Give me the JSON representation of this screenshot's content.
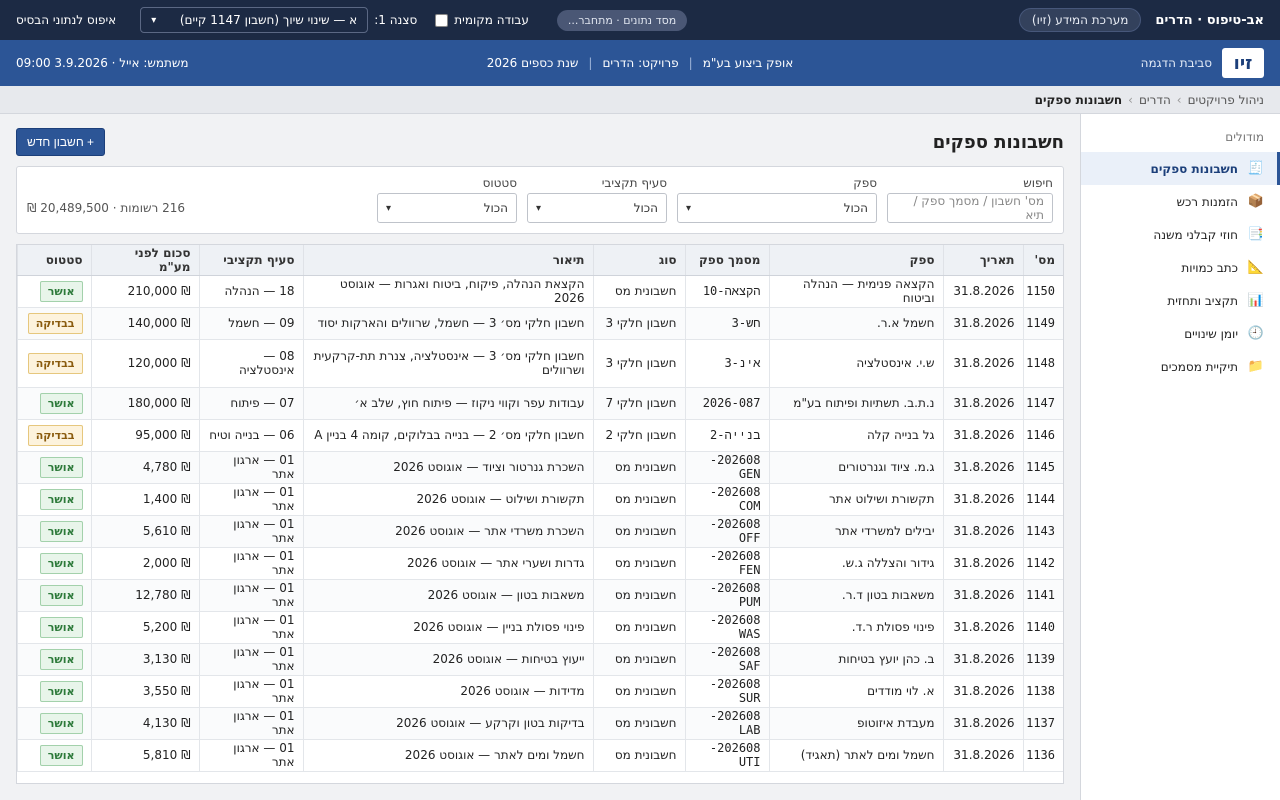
{
  "topbar": {
    "brand": "אב-טיפוס · הדרים",
    "system": "מערכת המידע (זיו)",
    "db_status": "מסד נתונים · מתחבר...",
    "local_work": "עבודה מקומית",
    "scenario_label": "סצנה 1:",
    "scenario_value": "א — שינוי שיוך (חשבון 1147 קיים)",
    "reset": "איפוס לנתוני הבסיס"
  },
  "band": {
    "logo": "זיו",
    "env": "סביבת הדגמה",
    "company": "אופק ביצוע בע\"מ",
    "project": "פרויקט: הדרים",
    "year": "שנת כספים 2026",
    "user": "משתמש: אייל · 3.9.2026 09:00"
  },
  "breadcrumb": [
    "ניהול פרויקטים",
    "הדרים",
    "חשבונות ספקים"
  ],
  "sidebar": {
    "heading": "מודולים",
    "items": [
      {
        "label": "חשבונות ספקים",
        "icon": "🧾",
        "active": true
      },
      {
        "label": "הזמנות רכש",
        "icon": "📦"
      },
      {
        "label": "חוזי קבלני משנה",
        "icon": "📑"
      },
      {
        "label": "כתב כמויות",
        "icon": "📐"
      },
      {
        "label": "תקציב ותחזית",
        "icon": "📊"
      },
      {
        "label": "יומן שינויים",
        "icon": "🕘"
      },
      {
        "label": "תיקיית מסמכים",
        "icon": "📁"
      }
    ]
  },
  "page": {
    "title": "חשבונות ספקים",
    "new_button": "+ חשבון חדש"
  },
  "filters": {
    "search_label": "חיפוש",
    "search_placeholder": "מס' חשבון / מסמך ספק / תיא",
    "supplier_label": "ספק",
    "supplier_value": "הכול",
    "budget_label": "סעיף תקציבי",
    "budget_value": "הכול",
    "status_label": "סטטוס",
    "status_value": "הכול",
    "summary": "216 רשומות · 20,489,500 ₪"
  },
  "table": {
    "headers": [
      "מס'",
      "תאריך",
      "ספק",
      "מסמך ספק",
      "סוג",
      "תיאור",
      "סעיף תקציבי",
      "סכום לפני מע\"מ",
      "סטטוס"
    ],
    "rows": [
      {
        "num": "1150",
        "date": "31.8.2026",
        "supplier": "הקצאה פנימית — הנהלה וביטוח",
        "doc": "הקצאה-10",
        "type": "חשבונית מס",
        "desc": "הקצאת הנהלה, פיקוח, ביטוח ואגרות — אוגוסט 2026",
        "budget": "18 — הנהלה",
        "amount": "₪ 210,000",
        "status": "אושר",
        "status_kind": "ok"
      },
      {
        "num": "1149",
        "date": "31.8.2026",
        "supplier": "חשמל א.ר.",
        "doc": "חש-3",
        "type": "חשבון חלקי 3",
        "desc": "חשבון חלקי מס׳ 3 — חשמל, שרוולים והארקות יסוד",
        "budget": "09 — חשמל",
        "amount": "₪ 140,000",
        "status": "בבדיקה",
        "status_kind": "chk"
      },
      {
        "num": "1148",
        "date": "31.8.2026",
        "supplier": "ש.י. אינסטלציה",
        "doc": "אינ-3",
        "type": "חשבון חלקי 3",
        "desc": "חשבון חלקי מס׳ 3 — אינסטלציה, צנרת תת-קרקעית ושרוולים",
        "budget": "08 — אינסטלציה",
        "amount": "₪ 120,000",
        "status": "בבדיקה",
        "status_kind": "chk",
        "tall": true
      },
      {
        "num": "1147",
        "date": "31.8.2026",
        "supplier": "נ.ת.ב. תשתיות ופיתוח בע\"מ",
        "doc": "2026-087",
        "type": "חשבון חלקי 7",
        "desc": "עבודות עפר וקווי ניקוז — פיתוח חוץ, שלב א׳",
        "budget": "07 — פיתוח",
        "amount": "₪ 180,000",
        "status": "אושר",
        "status_kind": "ok"
      },
      {
        "num": "1146",
        "date": "31.8.2026",
        "supplier": "גל בנייה קלה",
        "doc": "בנייה-2",
        "type": "חשבון חלקי 2",
        "desc": "חשבון חלקי מס׳ 2 — בנייה בבלוקים, קומה 4 בניין A",
        "budget": "06 — בנייה וטיח",
        "amount": "₪ 95,000",
        "status": "בבדיקה",
        "status_kind": "chk"
      },
      {
        "num": "1145",
        "date": "31.8.2026",
        "supplier": "ג.מ. ציוד וגנרטורים",
        "doc": "202608-GEN",
        "type": "חשבונית מס",
        "desc": "השכרת גנרטור וציוד — אוגוסט 2026",
        "budget": "01 — ארגון אתר",
        "amount": "₪ 4,780",
        "status": "אושר",
        "status_kind": "ok"
      },
      {
        "num": "1144",
        "date": "31.8.2026",
        "supplier": "תקשורת ושילוט אתר",
        "doc": "202608-COM",
        "type": "חשבונית מס",
        "desc": "תקשורת ושילוט — אוגוסט 2026",
        "budget": "01 — ארגון אתר",
        "amount": "₪ 1,400",
        "status": "אושר",
        "status_kind": "ok"
      },
      {
        "num": "1143",
        "date": "31.8.2026",
        "supplier": "יבילים למשרדי אתר",
        "doc": "202608-OFF",
        "type": "חשבונית מס",
        "desc": "השכרת משרדי אתר — אוגוסט 2026",
        "budget": "01 — ארגון אתר",
        "amount": "₪ 5,610",
        "status": "אושר",
        "status_kind": "ok"
      },
      {
        "num": "1142",
        "date": "31.8.2026",
        "supplier": "גידור והצללה ג.ש.",
        "doc": "202608-FEN",
        "type": "חשבונית מס",
        "desc": "גדרות ושערי אתר — אוגוסט 2026",
        "budget": "01 — ארגון אתר",
        "amount": "₪ 2,000",
        "status": "אושר",
        "status_kind": "ok"
      },
      {
        "num": "1141",
        "date": "31.8.2026",
        "supplier": "משאבות בטון ד.ר.",
        "doc": "202608-PUM",
        "type": "חשבונית מס",
        "desc": "משאבות בטון — אוגוסט 2026",
        "budget": "01 — ארגון אתר",
        "amount": "₪ 12,780",
        "status": "אושר",
        "status_kind": "ok"
      },
      {
        "num": "1140",
        "date": "31.8.2026",
        "supplier": "פינוי פסולת ר.ד.",
        "doc": "202608-WAS",
        "type": "חשבונית מס",
        "desc": "פינוי פסולת בניין — אוגוסט 2026",
        "budget": "01 — ארגון אתר",
        "amount": "₪ 5,200",
        "status": "אושר",
        "status_kind": "ok"
      },
      {
        "num": "1139",
        "date": "31.8.2026",
        "supplier": "ב. כהן יועץ בטיחות",
        "doc": "202608-SAF",
        "type": "חשבונית מס",
        "desc": "ייעוץ בטיחות — אוגוסט 2026",
        "budget": "01 — ארגון אתר",
        "amount": "₪ 3,130",
        "status": "אושר",
        "status_kind": "ok"
      },
      {
        "num": "1138",
        "date": "31.8.2026",
        "supplier": "א. לוי מודדים",
        "doc": "202608-SUR",
        "type": "חשבונית מס",
        "desc": "מדידות — אוגוסט 2026",
        "budget": "01 — ארגון אתר",
        "amount": "₪ 3,550",
        "status": "אושר",
        "status_kind": "ok"
      },
      {
        "num": "1137",
        "date": "31.8.2026",
        "supplier": "מעבדת איזוטופ",
        "doc": "202608-LAB",
        "type": "חשבונית מס",
        "desc": "בדיקות בטון וקרקע — אוגוסט 2026",
        "budget": "01 — ארגון אתר",
        "amount": "₪ 4,130",
        "status": "אושר",
        "status_kind": "ok"
      },
      {
        "num": "1136",
        "date": "31.8.2026",
        "supplier": "חשמל ומים לאתר (תאגיד)",
        "doc": "202608-UTI",
        "type": "חשבונית מס",
        "desc": "חשמל ומים לאתר — אוגוסט 2026",
        "budget": "01 — ארגון אתר",
        "amount": "₪ 5,810",
        "status": "אושר",
        "status_kind": "ok"
      }
    ]
  }
}
